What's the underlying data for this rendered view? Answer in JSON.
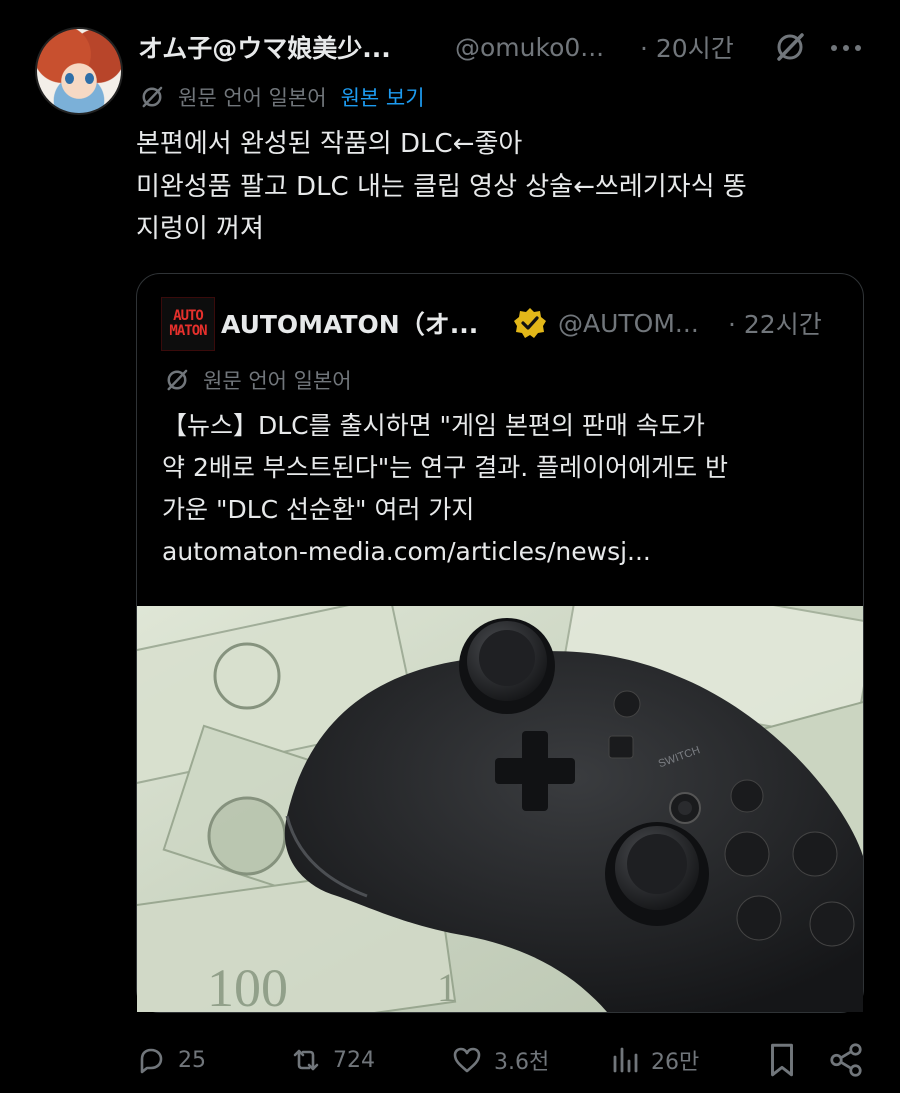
{
  "tweet": {
    "author_name": "オム子@ウマ娘美少...",
    "handle": "@omuko0...",
    "time": "· 20시간",
    "translate_note": "원문 언어 일본어",
    "view_original": "원본 보기",
    "body_lines": [
      "본편에서 완성된 작품의 DLC←좋아",
      "미완성품 팔고 DLC 내는 클립 영상 상술←쓰레기자식 똥",
      "지렁이 꺼져"
    ]
  },
  "quote": {
    "logo_lines": [
      "AUTO",
      "MATON"
    ],
    "author_name": "AUTOMATON（オ...",
    "handle": "@AUTOM...",
    "time": "· 22시간",
    "translate_note": "원문 언어 일본어",
    "text_lines": [
      "【뉴스】DLC를 출시하면 \"게임 본편의 판매 속도가",
      "약 2배로 부스트된다\"는 연구 결과. 플레이어에게도 반",
      "가운 \"DLC 선순환\" 여러 가지",
      "automaton-media.com/articles/newsj..."
    ]
  },
  "actions": {
    "replies": "25",
    "reposts": "724",
    "likes": "3.6천",
    "views": "26만"
  },
  "icons": {
    "grok": "grok-icon",
    "more": "more-icon",
    "translate": "translate-icon",
    "verified": "verified-badge-icon",
    "reply": "reply-icon",
    "repost": "repost-icon",
    "like": "heart-icon",
    "views": "views-icon",
    "bookmark": "bookmark-icon",
    "share": "share-icon"
  },
  "colors": {
    "background": "#000000",
    "text": "#e7e9ea",
    "secondary": "#71767b",
    "link": "#1d9bf0",
    "verified_gold": "#e2b719",
    "logo_red": "#e5302c"
  }
}
